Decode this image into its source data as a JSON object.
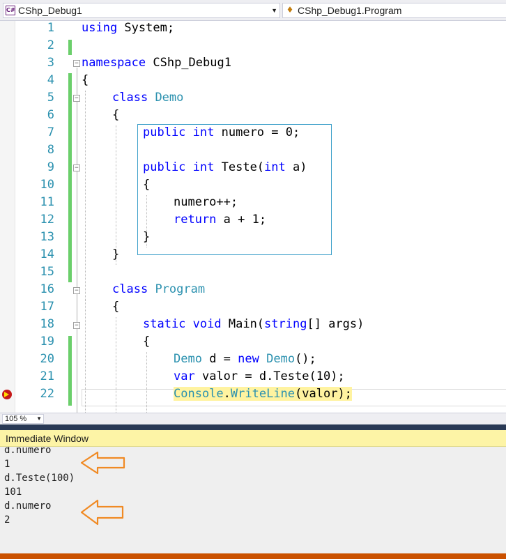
{
  "nav": {
    "project": "CShp_Debug1",
    "member": "CShp_Debug1.Program",
    "project_icon": "csharp-file-icon",
    "member_icon": "class-icon"
  },
  "editor": {
    "line_numbers": [
      "1",
      "2",
      "3",
      "4",
      "5",
      "6",
      "7",
      "8",
      "9",
      "10",
      "11",
      "12",
      "13",
      "14",
      "15",
      "16",
      "17",
      "18",
      "19",
      "20",
      "21",
      "22"
    ],
    "lines": {
      "l1": {
        "k1": "using",
        "t1": " System;"
      },
      "l3": {
        "k1": "namespace",
        "t1": " CShp_Debug1"
      },
      "l4": "{",
      "l5": {
        "k1": "class",
        "t1": " ",
        "y1": "Demo"
      },
      "l6": "{",
      "l7": {
        "k1": "public",
        "t1": " ",
        "k2": "int",
        "t2": " numero = 0;"
      },
      "l9": {
        "k1": "public",
        "t1": " ",
        "k2": "int",
        "t2": " Teste(",
        "k3": "int",
        "t3": " a)"
      },
      "l10": "{",
      "l11": "numero++;",
      "l12": {
        "k1": "return",
        "t1": " a + 1;"
      },
      "l13": "}",
      "l14": "}",
      "l16": {
        "k1": "class",
        "t1": " ",
        "y1": "Program"
      },
      "l17": "{",
      "l18": {
        "k1": "static",
        "t1": " ",
        "k2": "void",
        "t2": " Main(",
        "k3": "string",
        "t3": "[] args)"
      },
      "l19": "{",
      "l20": {
        "y1": "Demo",
        "t1": " d = ",
        "k1": "new",
        "t2": " ",
        "y2": "Demo",
        "t3": "();"
      },
      "l21": {
        "k1": "var",
        "t1": " valor = d.Teste(10);"
      },
      "l22": {
        "y1": "Console",
        "t1": ".",
        "y2": "WriteLine",
        "t2": "(valor);"
      }
    },
    "breakpoint_line": 22
  },
  "zoom": {
    "value": "105 %"
  },
  "immediate": {
    "title": "Immediate Window",
    "lines": [
      "d.numero",
      "1",
      "d.Teste(100)",
      "101",
      "d.numero",
      "2"
    ]
  },
  "colors": {
    "keyword": "#0000ff",
    "type": "#2b91af",
    "line_number": "#2b91af",
    "annotation_arrow": "#f08a24",
    "immediate_header": "#fdf4a6",
    "status_bar": "#ca5100"
  }
}
